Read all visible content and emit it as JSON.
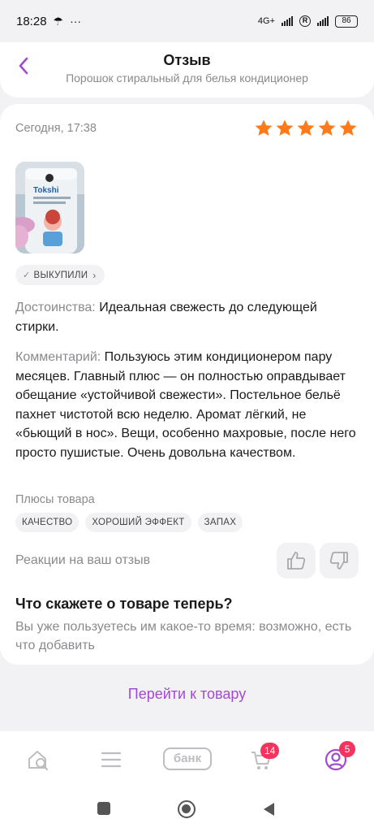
{
  "status_bar": {
    "time": "18:28",
    "battery": "86",
    "network": "4G+"
  },
  "header": {
    "title": "Отзыв",
    "subtitle": "Порошок стиральный для белья кондиционер"
  },
  "review": {
    "date": "Сегодня, 17:38",
    "rating": 5,
    "photo_label": "Tokshi",
    "bought_badge": "ВЫКУПИЛИ",
    "pros_label": "Достоинства:",
    "pros_text": "Идеальная свежесть до следующей стирки.",
    "comment_label": "Комментарий:",
    "comment_text": "Пользуюсь этим кондиционером пару месяцев. Главный плюс — он полностью оправдывает обещание «устойчивой свежести». Постельное бельё пахнет чистотой всю неделю. Аромат лёгкий, не «бьющий в нос». Вещи, особенно махровые, после него просто пушистые. Очень довольна качеством.",
    "plus_label": "Плюсы товара",
    "tags": [
      "КАЧЕСТВО",
      "ХОРОШИЙ ЭФФЕКТ",
      "ЗАПАХ"
    ],
    "reactions_label": "Реакции на ваш отзыв"
  },
  "question": {
    "title": "Что скажете о товаре теперь?",
    "text": "Вы уже пользуетесь им какое-то время: возможно, есть что добавить"
  },
  "goto_button": "Перейти к товару",
  "tabbar": {
    "bank_label": "банк",
    "cart_badge": "14",
    "profile_badge": "5"
  },
  "colors": {
    "accent": "#a24bd0",
    "star": "#ff7a1a",
    "badge": "#f4345f"
  }
}
